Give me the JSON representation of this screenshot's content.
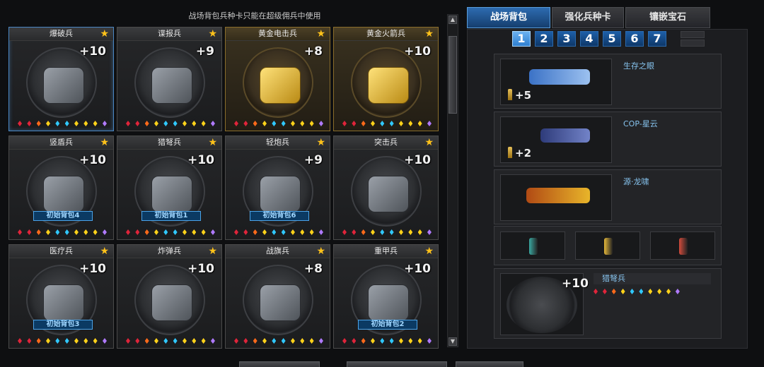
{
  "notice": "战场背包兵种卡只能在超级佣兵中使用",
  "cards": [
    {
      "name": "爆破兵",
      "level": "+10",
      "badge": "",
      "variant": "selected",
      "art": "grey"
    },
    {
      "name": "谍报兵",
      "level": "+9",
      "badge": "",
      "variant": "",
      "art": "grey"
    },
    {
      "name": "黄金电击兵",
      "level": "+8",
      "badge": "",
      "variant": "gold",
      "art": "gold"
    },
    {
      "name": "黄金火箭兵",
      "level": "+10",
      "badge": "",
      "variant": "gold",
      "art": "gold"
    },
    {
      "name": "竖盾兵",
      "level": "+10",
      "badge": "初始背包4",
      "variant": "",
      "art": "grey"
    },
    {
      "name": "猎弩兵",
      "level": "+10",
      "badge": "初始背包1",
      "variant": "",
      "art": "grey"
    },
    {
      "name": "轻炮兵",
      "level": "+9",
      "badge": "初始背包6",
      "variant": "",
      "art": "grey"
    },
    {
      "name": "突击兵",
      "level": "+10",
      "badge": "",
      "variant": "",
      "art": "grey"
    },
    {
      "name": "医疗兵",
      "level": "+10",
      "badge": "初始背包3",
      "variant": "",
      "art": "grey"
    },
    {
      "name": "炸弹兵",
      "level": "+10",
      "badge": "",
      "variant": "",
      "art": "grey"
    },
    {
      "name": "战旗兵",
      "level": "+8",
      "badge": "",
      "variant": "",
      "art": "grey"
    },
    {
      "name": "重甲兵",
      "level": "+10",
      "badge": "初始背包2",
      "variant": "",
      "art": "grey"
    }
  ],
  "gem_colors": [
    "#e0243a",
    "#e0243a",
    "#ff6a1a",
    "#ffd21a",
    "#30c8ff",
    "#30c8ff",
    "#ffd21a",
    "#ffd21a",
    "#ffd21a",
    "#b07aff"
  ],
  "tabs": [
    "战场背包",
    "强化兵种卡",
    "镶嵌宝石"
  ],
  "pages": [
    "1",
    "2",
    "3",
    "4",
    "5",
    "6",
    "7"
  ],
  "slots": [
    {
      "name": "生存之眼",
      "ammo": "+5",
      "weapon": "smg"
    },
    {
      "name": "COP-星云",
      "ammo": "+2",
      "weapon": "pistol"
    },
    {
      "name": "源·龙啸",
      "ammo": "",
      "weapon": "axe"
    }
  ],
  "mini_items": [
    {
      "color": "#3aa8a0"
    },
    {
      "color": "#e2b63a"
    },
    {
      "color": "#d24b3c"
    }
  ],
  "bottom": {
    "name": "猎弩兵",
    "level": "+10"
  }
}
